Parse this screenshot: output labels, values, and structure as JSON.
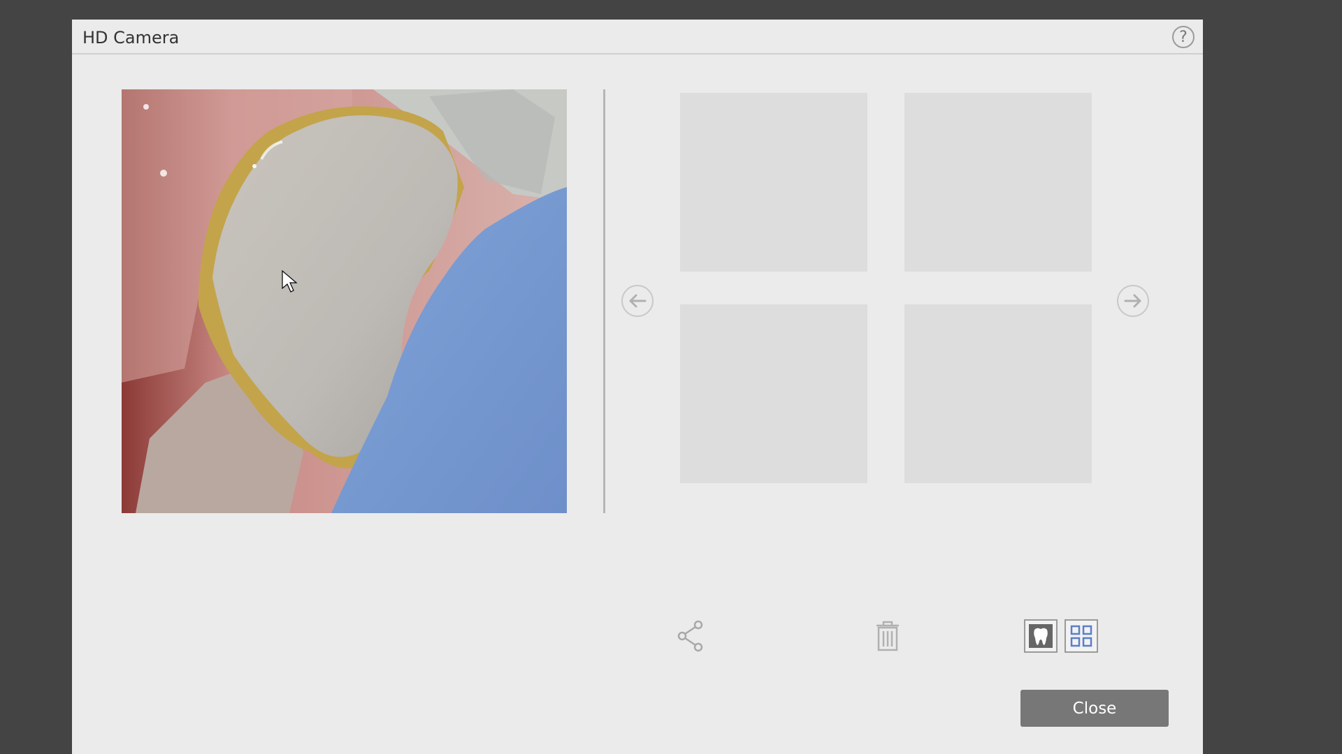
{
  "dialog": {
    "title": "HD Camera",
    "help_label": "?"
  },
  "live_view": {
    "description_icon": "intraoral-camera-feed"
  },
  "gallery": {
    "thumbnails": [
      "",
      "",
      "",
      ""
    ],
    "prev_icon": "arrow-left-icon",
    "next_icon": "arrow-right-icon"
  },
  "toolbar": {
    "share_icon": "share-icon",
    "delete_icon": "trash-icon",
    "tooth_view_icon": "tooth-icon",
    "grid_view_icon": "grid-icon"
  },
  "footer": {
    "close_label": "Close"
  },
  "colors": {
    "backdrop": "#444444",
    "dialog_bg": "#ebebeb",
    "thumb_bg": "#dddddd",
    "close_bg": "#777777",
    "grid_accent": "#5b7fc7"
  }
}
